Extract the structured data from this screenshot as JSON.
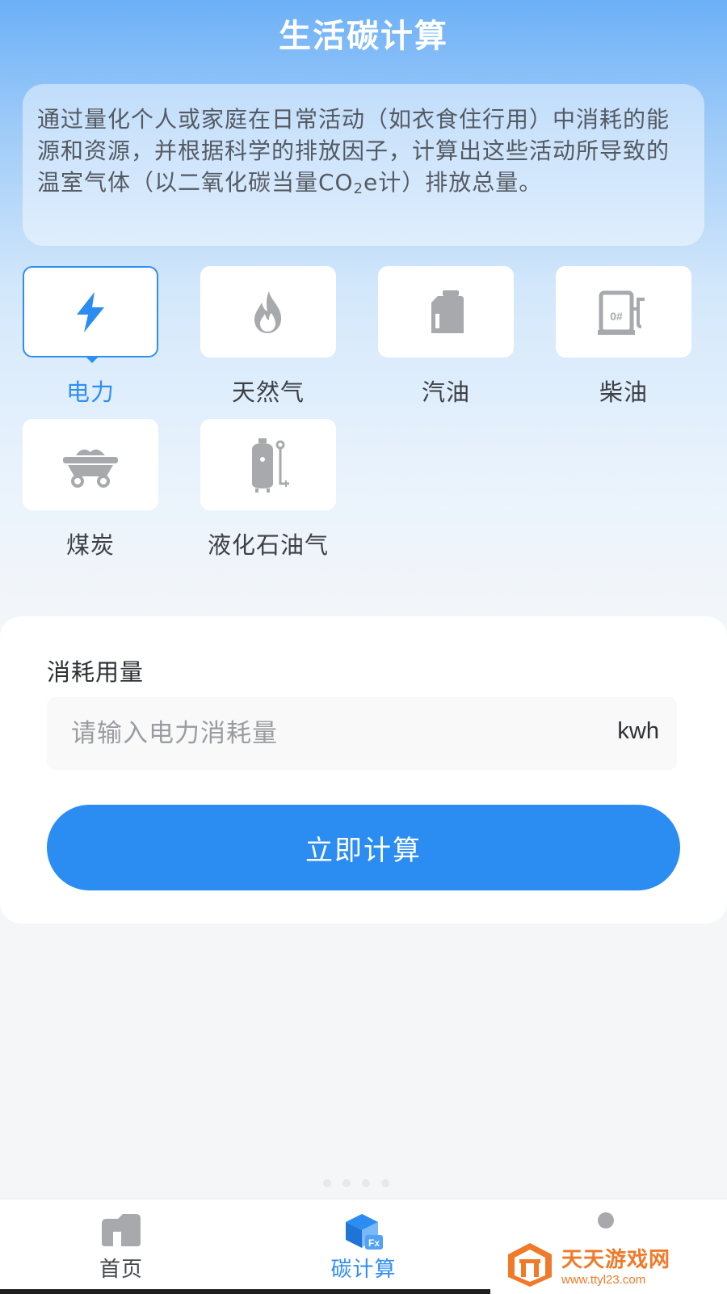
{
  "header": {
    "title": "生活碳计算"
  },
  "intro": {
    "text_before": "通过量化个人或家庭在日常活动（如衣食住行用）中消耗的能源和资源，并根据科学的排放因子，计算出这些活动所导致的温室气体（以二氧化碳当量CO",
    "subscript": "2",
    "text_after": "e计）排放总量。"
  },
  "fuel_types": {
    "selected": "电力",
    "items": [
      {
        "label": "电力",
        "icon": "lightning-icon"
      },
      {
        "label": "天然气",
        "icon": "flame-icon"
      },
      {
        "label": "汽油",
        "icon": "fuel-can-icon"
      },
      {
        "label": "柴油",
        "icon": "fuel-pump-icon"
      },
      {
        "label": "煤炭",
        "icon": "coal-cart-icon"
      },
      {
        "label": "液化石油气",
        "icon": "gas-cylinder-icon"
      }
    ]
  },
  "calculator": {
    "label": "消耗用量",
    "input_placeholder": "请输入电力消耗量",
    "input_value": "",
    "unit": "kwh",
    "button_label": "立即计算"
  },
  "tabbar": {
    "items": [
      {
        "label": "首页",
        "icon": "home-icon",
        "active": false
      },
      {
        "label": "碳计算",
        "icon": "cube-fx-icon",
        "active": true
      },
      {
        "label": "",
        "icon": "profile-icon",
        "active": false
      }
    ]
  },
  "watermark": {
    "name": "天天游戏网",
    "url": "www.ttyl23.com"
  },
  "colors": {
    "accent": "#2b8cf2",
    "accent_text": "#2f8ef4",
    "icon_gray": "#a7a9ac",
    "watermark": "#f07a2a"
  }
}
